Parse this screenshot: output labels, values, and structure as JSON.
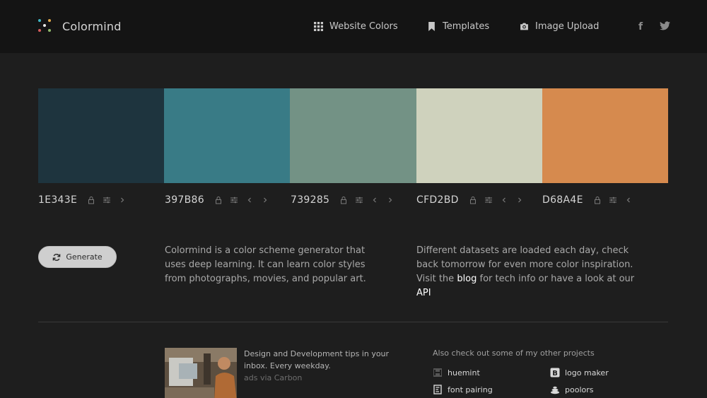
{
  "header": {
    "brand": "Colormind",
    "nav": [
      {
        "label": "Website Colors",
        "icon": "grid-icon"
      },
      {
        "label": "Templates",
        "icon": "bookmark-icon"
      },
      {
        "label": "Image Upload",
        "icon": "camera-icon"
      }
    ],
    "social": [
      {
        "label": "f",
        "icon": "facebook-icon"
      },
      {
        "label": "t",
        "icon": "twitter-icon"
      }
    ]
  },
  "palette": {
    "swatches": [
      {
        "code": "1E343E",
        "color": "#1E343E"
      },
      {
        "code": "397B86",
        "color": "#397B86"
      },
      {
        "code": "739285",
        "color": "#739285"
      },
      {
        "code": "CFD2BD",
        "color": "#CFD2BD"
      },
      {
        "code": "D68A4E",
        "color": "#D68A4E"
      }
    ]
  },
  "generate": {
    "label": "Generate"
  },
  "intro": {
    "text": "Colormind is a color scheme generator that uses deep learning. It can learn color styles from photographs, movies, and popular art."
  },
  "datasets": {
    "text_before": "Different datasets are loaded each day, check back tomorrow for even more color inspiration. Visit the",
    "blog_link": "blog",
    "text_middle": "for tech info or have a look at our",
    "api_link": "API"
  },
  "ad": {
    "text": "Design and Development tips in your inbox. Every weekday.",
    "via": "ads via Carbon"
  },
  "projects": {
    "title": "Also check out some of my other projects",
    "items": [
      {
        "label": "huemint",
        "icon": "huemint-icon"
      },
      {
        "label": "logo maker",
        "icon": "logo-maker-icon"
      },
      {
        "label": "font pairing",
        "icon": "font-pairing-icon"
      },
      {
        "label": "poolors",
        "icon": "poolors-icon"
      }
    ]
  }
}
